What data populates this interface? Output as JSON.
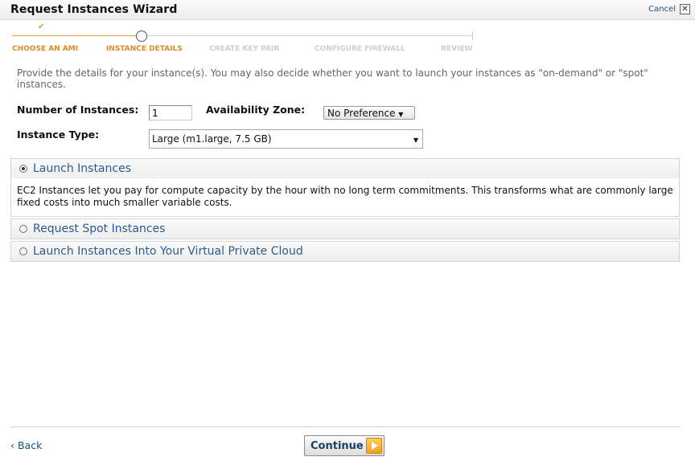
{
  "window": {
    "title": "Request Instances Wizard",
    "cancel_label": "Cancel",
    "close_glyph": "✕"
  },
  "steps": [
    {
      "label": "CHOOSE AN AMI",
      "state": "done",
      "marker": "✔"
    },
    {
      "label": "INSTANCE DETAILS",
      "state": "current"
    },
    {
      "label": "CREATE KEY PAIR",
      "state": "future"
    },
    {
      "label": "CONFIGURE FIREWALL",
      "state": "future"
    },
    {
      "label": "REVIEW",
      "state": "future"
    }
  ],
  "intro_text": "Provide the details for your instance(s). You may also decide whether you want to launch your instances as \"on-demand\" or \"spot\" instances.",
  "form": {
    "num_instances_label": "Number of Instances:",
    "num_instances_value": "1",
    "availability_zone_label": "Availability Zone:",
    "availability_zone_value": "No Preference",
    "instance_type_label": "Instance Type:",
    "instance_type_value": "Large (m1.large, 7.5 GB)",
    "dropdown_glyph": "▼"
  },
  "options": [
    {
      "label": "Launch Instances",
      "selected": true,
      "description": "EC2 Instances let you pay for compute capacity by the hour with no long term commitments. This transforms what are commonly large fixed costs into much smaller variable costs."
    },
    {
      "label": "Request Spot Instances",
      "selected": false
    },
    {
      "label": "Launch Instances Into Your Virtual Private Cloud",
      "selected": false
    }
  ],
  "footer": {
    "back_label": "‹ Back",
    "continue_label": "Continue"
  },
  "colors": {
    "accent_orange": "#e08a2a",
    "link_blue": "#1a4f8b",
    "option_title_blue": "#2d5b8e"
  },
  "icons": {
    "step_done": "check-icon",
    "close": "close-icon",
    "continue": "play-arrow-icon"
  }
}
